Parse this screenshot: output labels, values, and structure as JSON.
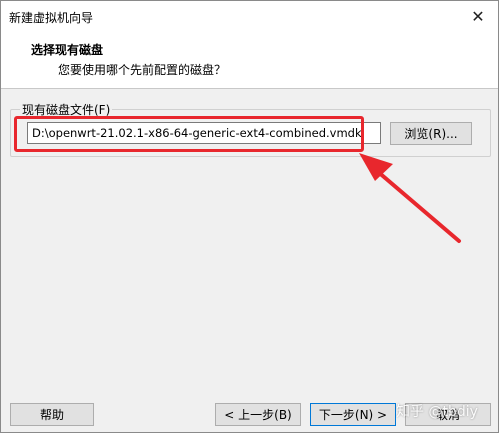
{
  "window": {
    "title": "新建虚拟机向导",
    "close_glyph": "✕"
  },
  "header": {
    "title": "选择现有磁盘",
    "subtitle": "您要使用哪个先前配置的磁盘？"
  },
  "disk_group": {
    "label": "现有磁盘文件(F)",
    "file_path": "D:\\openwrt-21.02.1-x86-64-generic-ext4-combined.vmdk",
    "browse_label": "浏览(R)..."
  },
  "footer": {
    "help_label": "帮助",
    "back_label": "< 上一步(B)",
    "next_label": "下一步(N) >",
    "cancel_label": "取消"
  },
  "watermark": {
    "text": "知乎 @tbdiy"
  },
  "colors": {
    "highlight": "#e8272d",
    "focus_border": "#0078d7"
  },
  "icons": {
    "close": "close-icon",
    "annotation": "red-arrow-icon"
  }
}
